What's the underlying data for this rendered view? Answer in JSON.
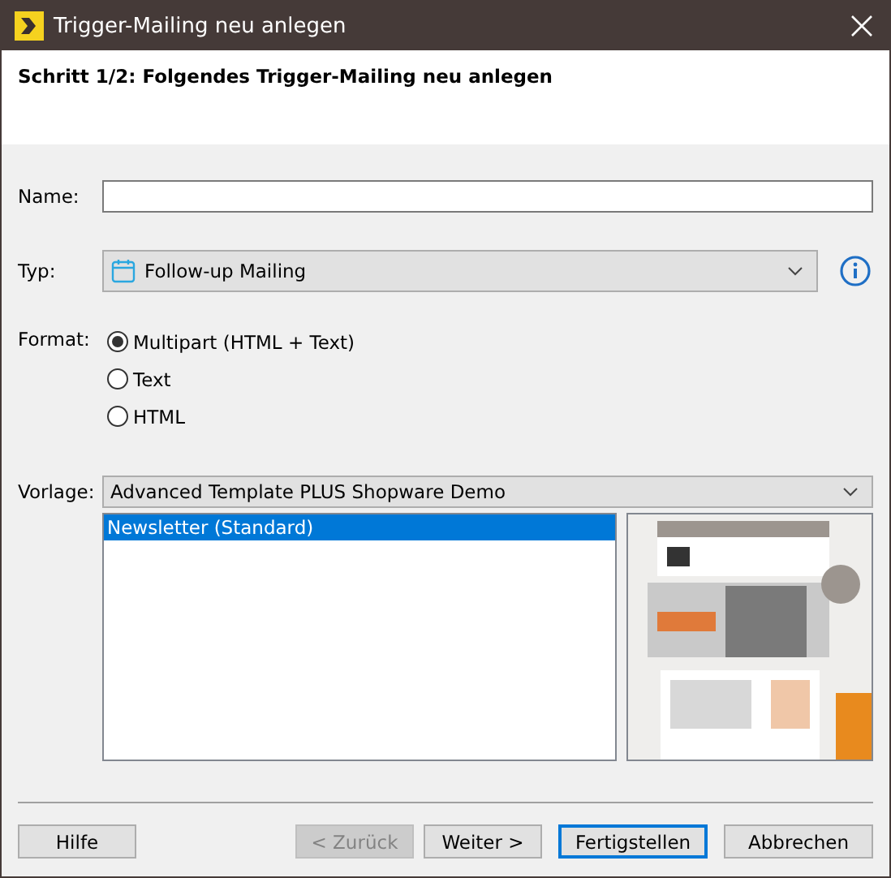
{
  "window": {
    "title": "Trigger-Mailing neu anlegen"
  },
  "header": {
    "title": "Schritt 1/2: Folgendes Trigger-Mailing neu anlegen"
  },
  "name_field": {
    "label": "Name:"
  },
  "type_field": {
    "label": "Typ:",
    "value": "Follow-up Mailing"
  },
  "format": {
    "label": "Format:",
    "options": [
      {
        "label": "Multipart (HTML + Text)",
        "selected": true
      },
      {
        "label": "Text",
        "selected": false
      },
      {
        "label": "HTML",
        "selected": false
      }
    ]
  },
  "template": {
    "label": "Vorlage:",
    "value": "Advanced Template PLUS Shopware Demo",
    "items": [
      {
        "label": "Newsletter (Standard)",
        "selected": true
      }
    ]
  },
  "buttons": [
    {
      "label": "Hilfe",
      "disabled": false,
      "default": false
    },
    {
      "label": "< Zurück",
      "disabled": true,
      "default": false
    },
    {
      "label": "Weiter >",
      "disabled": false,
      "default": false
    },
    {
      "label": "Fertigstellen",
      "disabled": false,
      "default": true
    },
    {
      "label": "Abbrechen",
      "disabled": false,
      "default": false
    }
  ]
}
